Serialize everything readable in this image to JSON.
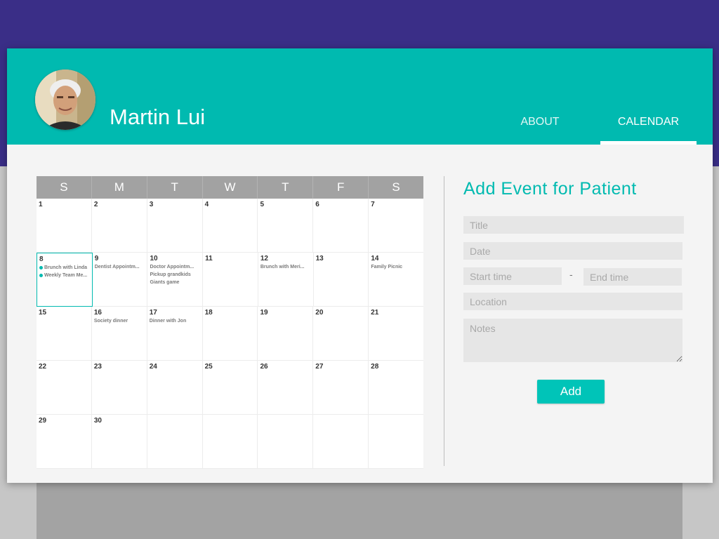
{
  "colors": {
    "accent": "#00bab0",
    "backdrop": "#3a2e87",
    "calendar_header": "#a2a2a2"
  },
  "header": {
    "patient_name": "Martin Lui",
    "avatar": "patient-photo",
    "tabs": [
      {
        "label": "ABOUT",
        "active": false
      },
      {
        "label": "CALENDAR",
        "active": true
      }
    ]
  },
  "calendar": {
    "weekdays": [
      "S",
      "M",
      "T",
      "W",
      "T",
      "F",
      "S"
    ],
    "selected_day": "8",
    "weeks": [
      [
        {
          "day": "1",
          "events": []
        },
        {
          "day": "2",
          "events": []
        },
        {
          "day": "3",
          "events": []
        },
        {
          "day": "4",
          "events": []
        },
        {
          "day": "5",
          "events": []
        },
        {
          "day": "6",
          "events": []
        },
        {
          "day": "7",
          "events": []
        }
      ],
      [
        {
          "day": "8",
          "events": [
            "Brunch with Linda",
            "Weekly Team Me..."
          ]
        },
        {
          "day": "9",
          "events": [
            "Dentist Appointm..."
          ]
        },
        {
          "day": "10",
          "events": [
            "Doctor Appointm...",
            "Pickup grandkids",
            "Giants game"
          ]
        },
        {
          "day": "11",
          "events": []
        },
        {
          "day": "12",
          "events": [
            "Brunch with Meri..."
          ]
        },
        {
          "day": "13",
          "events": []
        },
        {
          "day": "14",
          "events": [
            "Family Picnic"
          ]
        }
      ],
      [
        {
          "day": "15",
          "events": []
        },
        {
          "day": "16",
          "events": [
            "Society dinner"
          ]
        },
        {
          "day": "17",
          "events": [
            "Dinner with Jon"
          ]
        },
        {
          "day": "18",
          "events": []
        },
        {
          "day": "19",
          "events": []
        },
        {
          "day": "20",
          "events": []
        },
        {
          "day": "21",
          "events": []
        }
      ],
      [
        {
          "day": "22",
          "events": []
        },
        {
          "day": "23",
          "events": []
        },
        {
          "day": "24",
          "events": []
        },
        {
          "day": "25",
          "events": []
        },
        {
          "day": "26",
          "events": []
        },
        {
          "day": "27",
          "events": []
        },
        {
          "day": "28",
          "events": []
        }
      ],
      [
        {
          "day": "29",
          "events": []
        },
        {
          "day": "30",
          "events": []
        },
        {
          "day": "",
          "events": []
        },
        {
          "day": "",
          "events": []
        },
        {
          "day": "",
          "events": []
        },
        {
          "day": "",
          "events": []
        },
        {
          "day": "",
          "events": []
        }
      ]
    ]
  },
  "form": {
    "title": "Add Event for Patient",
    "title_placeholder": "Title",
    "date_placeholder": "Date",
    "start_placeholder": "Start time",
    "separator": "-",
    "end_placeholder": "End time",
    "location_placeholder": "Location",
    "notes_placeholder": "Notes",
    "add_label": "Add"
  }
}
